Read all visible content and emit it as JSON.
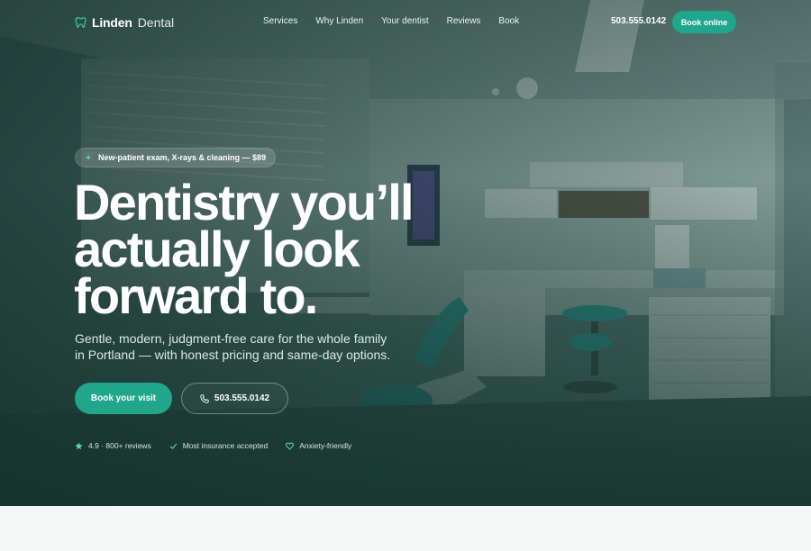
{
  "brand": {
    "name_strong": "Linden",
    "name_light": "Dental",
    "logo_icon": "tooth-icon"
  },
  "nav": {
    "links": [
      "Services",
      "Why Linden",
      "Your dentist",
      "Reviews",
      "Book"
    ],
    "phone": "503.555.0142",
    "cta": "Book online"
  },
  "hero": {
    "badge_icon": "sparkle-icon",
    "badge": "New-patient exam, X-rays & cleaning — $89",
    "headline": [
      "Dentistry you’ll",
      "actually look",
      "forward to."
    ],
    "subheadline": "Gentle, modern, judgment-free care for the whole family in Portland — with honest pricing and same-day options.",
    "primary_cta": "Book your visit",
    "secondary_cta": "503.555.0142",
    "secondary_icon": "phone-icon",
    "trust": [
      {
        "icon": "star-icon",
        "text": "4.9 · 800+ reviews"
      },
      {
        "icon": "check-icon",
        "text": "Most insurance accepted"
      },
      {
        "icon": "heart-icon",
        "text": "Anxiety-friendly"
      }
    ]
  },
  "colors": {
    "accent": "#1fa68c",
    "hero_overlay": "#16342e",
    "page_bg": "#f3f7f6"
  }
}
